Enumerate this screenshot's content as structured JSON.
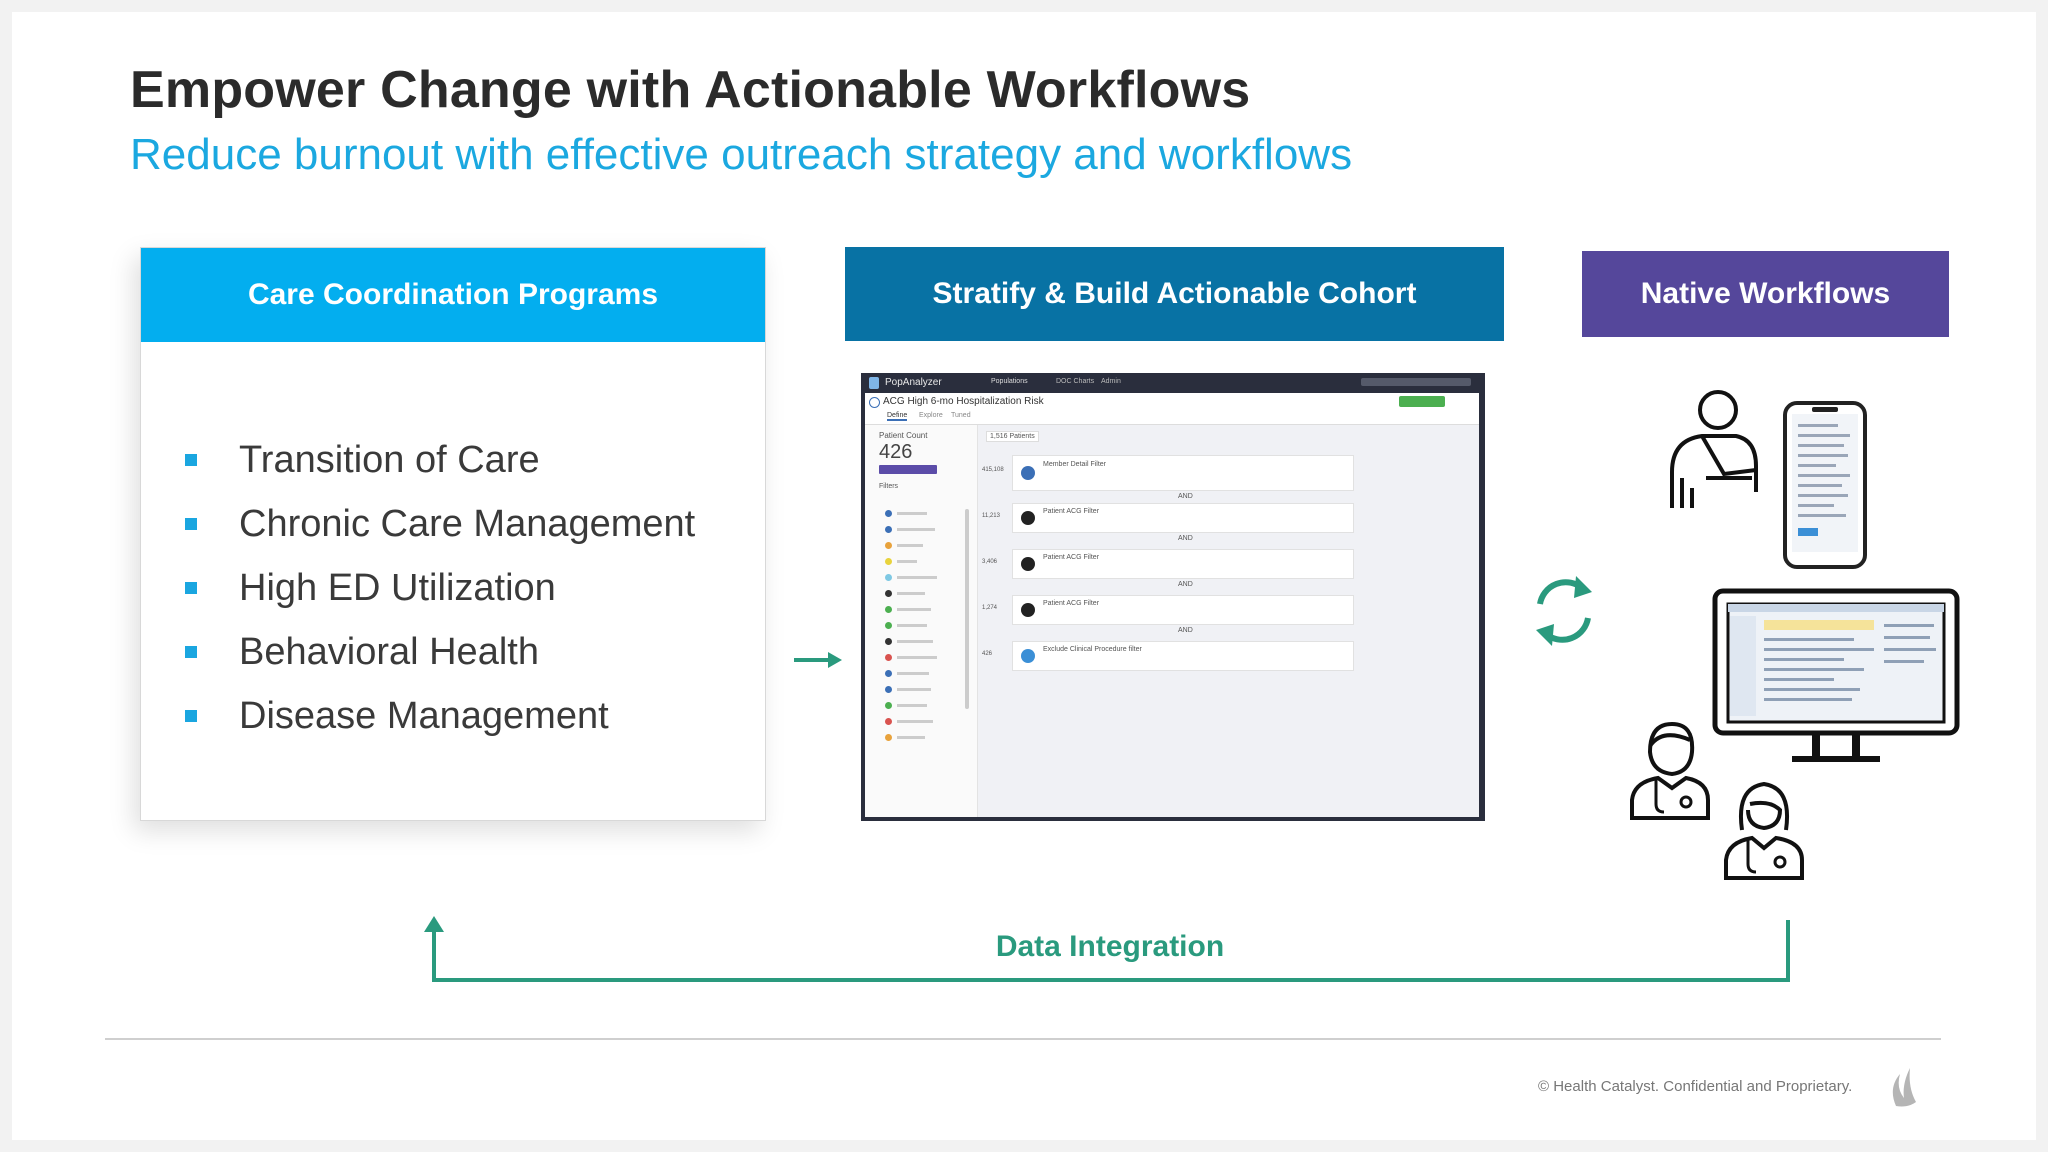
{
  "title": "Empower Change with Actionable Workflows",
  "subtitle": "Reduce burnout with effective outreach strategy and workflows",
  "programs": {
    "header": "Care Coordination Programs",
    "items": [
      "Transition of Care",
      "Chronic Care Management",
      "High ED Utilization",
      "Behavioral Health",
      "Disease Management"
    ]
  },
  "stratify": {
    "header": "Stratify & Build Actionable Cohort",
    "screenshot": {
      "app_name": "PopAnalyzer",
      "nav": [
        "Populations",
        "DOC Charts",
        "Admin"
      ],
      "cohort_title": "ACG High 6-mo Hospitalization Risk",
      "tabs": [
        "Define",
        "Explore",
        "Tuned"
      ],
      "patient_count_label": "Patient Count",
      "patient_count": "426",
      "filters_label": "Filters",
      "cohort_header": "1,516 Patients",
      "nodes": [
        {
          "count": "415,108",
          "label": "Member Detail Filter"
        },
        {
          "count": "11,213",
          "label": "Patient ACG Filter"
        },
        {
          "count": "3,406",
          "label": "Patient ACG Filter"
        },
        {
          "count": "1,274",
          "label": "Patient ACG Filter"
        },
        {
          "count": "426",
          "label": "Exclude Clinical Procedure filter"
        }
      ],
      "connector": "AND"
    }
  },
  "native": {
    "header": "Native Workflows"
  },
  "data_integration": "Data Integration",
  "footer": "© Health Catalyst. Confidential and Proprietary.",
  "colors": {
    "cyan": "#03aeef",
    "blue": "#0872a4",
    "purple": "#55479b",
    "green": "#2a9a7e"
  }
}
